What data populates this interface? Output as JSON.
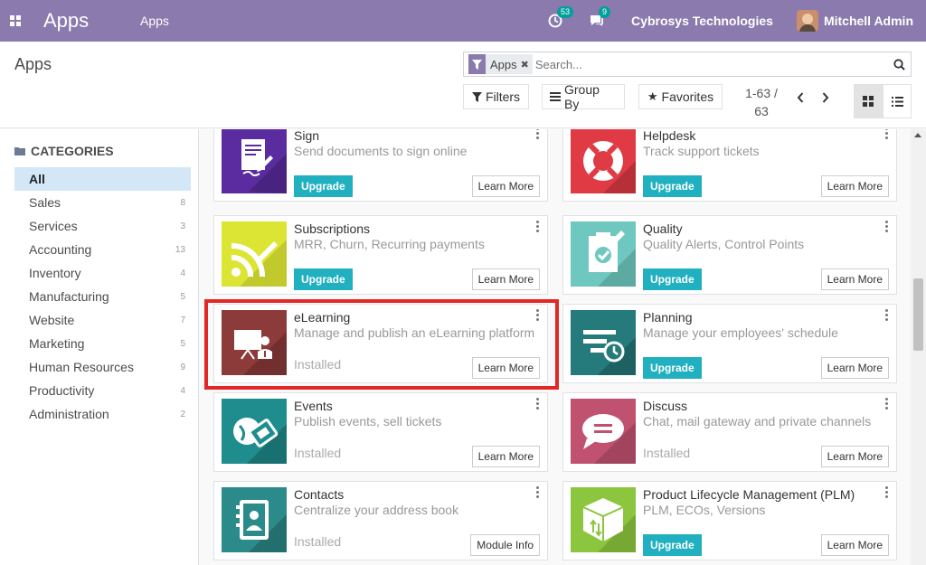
{
  "navbar": {
    "brand": "Apps",
    "menu_item": "Apps",
    "activity_count": "53",
    "messages_count": "9",
    "company": "Cybrosys Technologies",
    "user": "Mitchell Admin",
    "color": "#8a7aad"
  },
  "control": {
    "breadcrumb": "Apps",
    "search": {
      "facet_label": "Apps",
      "placeholder": "Search...",
      "facet_icon": "filter-icon",
      "search_icon": "magnifier-icon"
    },
    "filters_label": "Filters",
    "group_by_label": "Group By",
    "favorites_label": "Favorites",
    "pager": {
      "value": "1-63 /",
      "total": "63"
    },
    "view": {
      "active": "kanban"
    }
  },
  "sidebar": {
    "header": "CATEGORIES",
    "categories": [
      {
        "label": "All",
        "count": ""
      },
      {
        "label": "Sales",
        "count": "8"
      },
      {
        "label": "Services",
        "count": "3"
      },
      {
        "label": "Accounting",
        "count": "13"
      },
      {
        "label": "Inventory",
        "count": "4"
      },
      {
        "label": "Manufacturing",
        "count": "5"
      },
      {
        "label": "Website",
        "count": "7"
      },
      {
        "label": "Marketing",
        "count": "5"
      },
      {
        "label": "Human Resources",
        "count": "9"
      },
      {
        "label": "Productivity",
        "count": "4"
      },
      {
        "label": "Administration",
        "count": "2"
      }
    ]
  },
  "apps": [
    {
      "name": "Sign",
      "summary": "Send documents to sign online",
      "status": "Upgrade",
      "button": "Learn More",
      "icon": "sign-document-icon",
      "color": "#5b2c9f"
    },
    {
      "name": "Helpdesk",
      "summary": "Track support tickets",
      "status": "Upgrade",
      "button": "Learn More",
      "icon": "lifebuoy-icon",
      "color": "#e03a44"
    },
    {
      "name": "Subscriptions",
      "summary": "MRR, Churn, Recurring payments",
      "status": "Upgrade",
      "button": "Learn More",
      "icon": "rss-pencil-icon",
      "color": "#dce533"
    },
    {
      "name": "Quality",
      "summary": "Quality Alerts, Control Points",
      "status": "Upgrade",
      "button": "Learn More",
      "icon": "clipboard-check-icon",
      "color": "#6ec8c0"
    },
    {
      "name": "eLearning",
      "summary": "Manage and publish an eLearning platform",
      "status": "Installed",
      "button": "Learn More",
      "icon": "teacher-board-icon",
      "color": "#8c3a3a"
    },
    {
      "name": "Planning",
      "summary": "Manage your employees' schedule",
      "status": "Upgrade",
      "button": "Learn More",
      "icon": "schedule-clock-icon",
      "color": "#257a7b"
    },
    {
      "name": "Events",
      "summary": "Publish events, sell tickets",
      "status": "Installed",
      "button": "Learn More",
      "icon": "ticket-globe-icon",
      "color": "#1f8d8d"
    },
    {
      "name": "Discuss",
      "summary": "Chat, mail gateway and private channels",
      "status": "Installed",
      "button": "Learn More",
      "icon": "chat-bubble-icon",
      "color": "#c0516f"
    },
    {
      "name": "Contacts",
      "summary": "Centralize your address book",
      "status": "Installed",
      "button": "Module Info",
      "icon": "address-book-icon",
      "color": "#2b8b8a"
    },
    {
      "name": "Product Lifecycle Management (PLM)",
      "summary": "PLM, ECOs, Versions",
      "status": "Upgrade",
      "button": "Learn More",
      "icon": "package-arrows-icon",
      "color": "#8cc63e"
    }
  ],
  "accent_upgrade": "#21b0c0",
  "highlight_color": "#e32726"
}
